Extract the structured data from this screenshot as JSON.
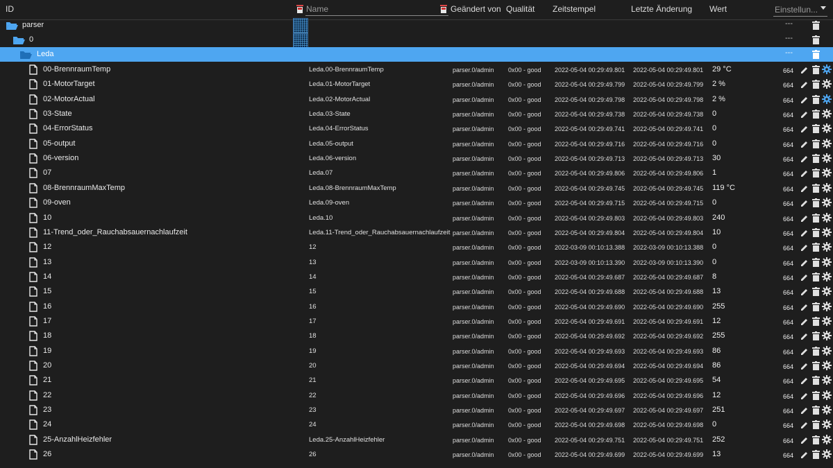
{
  "header": {
    "id": "ID",
    "name": "Name",
    "changed_by": "Geändert von",
    "quality": "Qualität",
    "timestamp": "Zeitstempel",
    "last_change": "Letzte Änderung",
    "value": "Wert",
    "settings": "Einstellun..."
  },
  "colors": {
    "selected_row": "#4ea6f1",
    "folder": "#4ea6f1",
    "background": "#1e1e1e"
  },
  "tree": {
    "parser": {
      "label": "parser",
      "dash": "---"
    },
    "zero": {
      "label": "0",
      "dash": "---"
    },
    "leda": {
      "label": "Leda",
      "dash": "---"
    }
  },
  "states": [
    {
      "id": "00-BrennraumTemp",
      "name": "Leda.00-BrennraumTemp",
      "from": "parser.0/admin",
      "q": "0x00 - good",
      "ts": "2022-05-04 00:29:49.801",
      "lc": "2022-05-04 00:29:49.801",
      "val": "29 °C",
      "acl": "664",
      "gear": "blue"
    },
    {
      "id": "01-MotorTarget",
      "name": "Leda.01-MotorTarget",
      "from": "parser.0/admin",
      "q": "0x00 - good",
      "ts": "2022-05-04 00:29:49.799",
      "lc": "2022-05-04 00:29:49.799",
      "val": "2 %",
      "acl": "664",
      "gear": "white"
    },
    {
      "id": "02-MotorActual",
      "name": "Leda.02-MotorActual",
      "from": "parser.0/admin",
      "q": "0x00 - good",
      "ts": "2022-05-04 00:29:49.798",
      "lc": "2022-05-04 00:29:49.798",
      "val": "2 %",
      "acl": "664",
      "gear": "blue"
    },
    {
      "id": "03-State",
      "name": "Leda.03-State",
      "from": "parser.0/admin",
      "q": "0x00 - good",
      "ts": "2022-05-04 00:29:49.738",
      "lc": "2022-05-04 00:29:49.738",
      "val": "0",
      "acl": "664",
      "gear": "white"
    },
    {
      "id": "04-ErrorStatus",
      "name": "Leda.04-ErrorStatus",
      "from": "parser.0/admin",
      "q": "0x00 - good",
      "ts": "2022-05-04 00:29:49.741",
      "lc": "2022-05-04 00:29:49.741",
      "val": "0",
      "acl": "664",
      "gear": "white"
    },
    {
      "id": "05-output",
      "name": "Leda.05-output",
      "from": "parser.0/admin",
      "q": "0x00 - good",
      "ts": "2022-05-04 00:29:49.716",
      "lc": "2022-05-04 00:29:49.716",
      "val": "0",
      "acl": "664",
      "gear": "white"
    },
    {
      "id": "06-version",
      "name": "Leda.06-version",
      "from": "parser.0/admin",
      "q": "0x00 - good",
      "ts": "2022-05-04 00:29:49.713",
      "lc": "2022-05-04 00:29:49.713",
      "val": "30",
      "acl": "664",
      "gear": "white"
    },
    {
      "id": "07",
      "name": "Leda.07",
      "from": "parser.0/admin",
      "q": "0x00 - good",
      "ts": "2022-05-04 00:29:49.806",
      "lc": "2022-05-04 00:29:49.806",
      "val": "1",
      "acl": "664",
      "gear": "white"
    },
    {
      "id": "08-BrennraumMaxTemp",
      "name": "Leda.08-BrennraumMaxTemp",
      "from": "parser.0/admin",
      "q": "0x00 - good",
      "ts": "2022-05-04 00:29:49.745",
      "lc": "2022-05-04 00:29:49.745",
      "val": "119 °C",
      "acl": "664",
      "gear": "white"
    },
    {
      "id": "09-oven",
      "name": "Leda.09-oven",
      "from": "parser.0/admin",
      "q": "0x00 - good",
      "ts": "2022-05-04 00:29:49.715",
      "lc": "2022-05-04 00:29:49.715",
      "val": "0",
      "acl": "664",
      "gear": "white"
    },
    {
      "id": "10",
      "name": "Leda.10",
      "from": "parser.0/admin",
      "q": "0x00 - good",
      "ts": "2022-05-04 00:29:49.803",
      "lc": "2022-05-04 00:29:49.803",
      "val": "240",
      "acl": "664",
      "gear": "white"
    },
    {
      "id": "11-Trend_oder_Rauchabsauernachlaufzeit",
      "name": "Leda.11-Trend_oder_Rauchabsauernachlaufzeit",
      "from": "parser.0/admin",
      "q": "0x00 - good",
      "ts": "2022-05-04 00:29:49.804",
      "lc": "2022-05-04 00:29:49.804",
      "val": "10",
      "acl": "664",
      "gear": "white"
    },
    {
      "id": "12",
      "name": "12",
      "from": "parser.0/admin",
      "q": "0x00 - good",
      "ts": "2022-03-09 00:10:13.388",
      "lc": "2022-03-09 00:10:13.388",
      "val": "0",
      "acl": "664",
      "gear": "white"
    },
    {
      "id": "13",
      "name": "13",
      "from": "parser.0/admin",
      "q": "0x00 - good",
      "ts": "2022-03-09 00:10:13.390",
      "lc": "2022-03-09 00:10:13.390",
      "val": "0",
      "acl": "664",
      "gear": "white"
    },
    {
      "id": "14",
      "name": "14",
      "from": "parser.0/admin",
      "q": "0x00 - good",
      "ts": "2022-05-04 00:29:49.687",
      "lc": "2022-05-04 00:29:49.687",
      "val": "8",
      "acl": "664",
      "gear": "white"
    },
    {
      "id": "15",
      "name": "15",
      "from": "parser.0/admin",
      "q": "0x00 - good",
      "ts": "2022-05-04 00:29:49.688",
      "lc": "2022-05-04 00:29:49.688",
      "val": "13",
      "acl": "664",
      "gear": "white"
    },
    {
      "id": "16",
      "name": "16",
      "from": "parser.0/admin",
      "q": "0x00 - good",
      "ts": "2022-05-04 00:29:49.690",
      "lc": "2022-05-04 00:29:49.690",
      "val": "255",
      "acl": "664",
      "gear": "white"
    },
    {
      "id": "17",
      "name": "17",
      "from": "parser.0/admin",
      "q": "0x00 - good",
      "ts": "2022-05-04 00:29:49.691",
      "lc": "2022-05-04 00:29:49.691",
      "val": "12",
      "acl": "664",
      "gear": "white"
    },
    {
      "id": "18",
      "name": "18",
      "from": "parser.0/admin",
      "q": "0x00 - good",
      "ts": "2022-05-04 00:29:49.692",
      "lc": "2022-05-04 00:29:49.692",
      "val": "255",
      "acl": "664",
      "gear": "white"
    },
    {
      "id": "19",
      "name": "19",
      "from": "parser.0/admin",
      "q": "0x00 - good",
      "ts": "2022-05-04 00:29:49.693",
      "lc": "2022-05-04 00:29:49.693",
      "val": "86",
      "acl": "664",
      "gear": "white"
    },
    {
      "id": "20",
      "name": "20",
      "from": "parser.0/admin",
      "q": "0x00 - good",
      "ts": "2022-05-04 00:29:49.694",
      "lc": "2022-05-04 00:29:49.694",
      "val": "86",
      "acl": "664",
      "gear": "white"
    },
    {
      "id": "21",
      "name": "21",
      "from": "parser.0/admin",
      "q": "0x00 - good",
      "ts": "2022-05-04 00:29:49.695",
      "lc": "2022-05-04 00:29:49.695",
      "val": "54",
      "acl": "664",
      "gear": "white"
    },
    {
      "id": "22",
      "name": "22",
      "from": "parser.0/admin",
      "q": "0x00 - good",
      "ts": "2022-05-04 00:29:49.696",
      "lc": "2022-05-04 00:29:49.696",
      "val": "12",
      "acl": "664",
      "gear": "white"
    },
    {
      "id": "23",
      "name": "23",
      "from": "parser.0/admin",
      "q": "0x00 - good",
      "ts": "2022-05-04 00:29:49.697",
      "lc": "2022-05-04 00:29:49.697",
      "val": "251",
      "acl": "664",
      "gear": "white"
    },
    {
      "id": "24",
      "name": "24",
      "from": "parser.0/admin",
      "q": "0x00 - good",
      "ts": "2022-05-04 00:29:49.698",
      "lc": "2022-05-04 00:29:49.698",
      "val": "0",
      "acl": "664",
      "gear": "white"
    },
    {
      "id": "25-AnzahlHeizfehler",
      "name": "Leda.25-AnzahlHeizfehler",
      "from": "parser.0/admin",
      "q": "0x00 - good",
      "ts": "2022-05-04 00:29:49.751",
      "lc": "2022-05-04 00:29:49.751",
      "val": "252",
      "acl": "664",
      "gear": "white"
    },
    {
      "id": "26",
      "name": "26",
      "from": "parser.0/admin",
      "q": "0x00 - good",
      "ts": "2022-05-04 00:29:49.699",
      "lc": "2022-05-04 00:29:49.699",
      "val": "13",
      "acl": "664",
      "gear": "white"
    }
  ]
}
